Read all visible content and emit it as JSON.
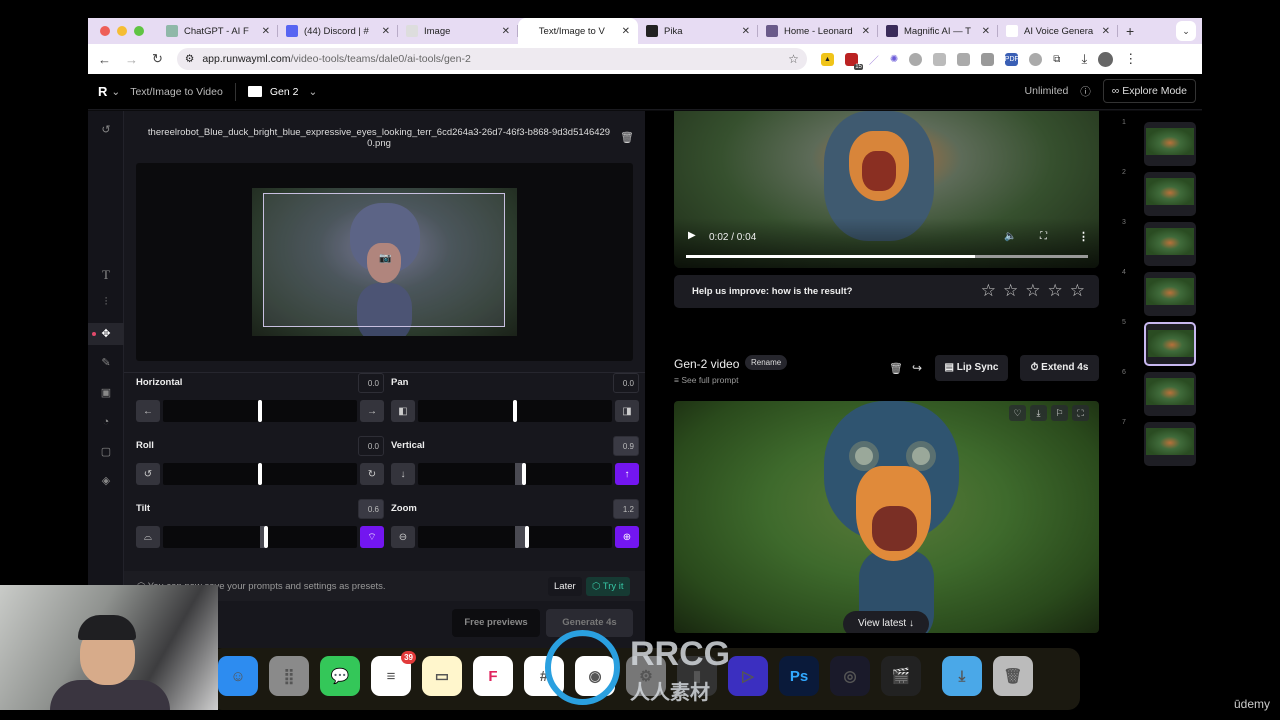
{
  "browser": {
    "tabs": [
      {
        "title": "ChatGPT - AI F",
        "favicon": "chatgpt-icon",
        "color": "#8fb8a8"
      },
      {
        "title": "(44) Discord | #",
        "favicon": "discord-icon",
        "color": "#5865f2"
      },
      {
        "title": "Image",
        "favicon": "image-icon",
        "color": "#dddddd"
      },
      {
        "title": "Text/Image to V",
        "favicon": "",
        "color": "#ffffff",
        "active": true
      },
      {
        "title": "Pika",
        "favicon": "pika-icon",
        "color": "#222222"
      },
      {
        "title": "Home - Leonard",
        "favicon": "leonardo-icon",
        "color": "#6a5a8a"
      },
      {
        "title": "Magnific AI — T",
        "favicon": "magnific-icon",
        "color": "#3a2b5a"
      },
      {
        "title": "AI Voice Genera",
        "favicon": "elevenlabs-icon",
        "color": "#ffffff"
      }
    ],
    "url_host": "app.runwayml.com",
    "url_path": "/video-tools/teams/dale0/ai-tools/gen-2",
    "extension_badge": "15"
  },
  "app": {
    "breadcrumb_tool": "Text/Image to Video",
    "folder": "Gen 2",
    "plan": "Unlimited",
    "explore_mode": "Explore Mode"
  },
  "left_panel": {
    "filename": "thereelrobot_Blue_duck_bright_blue_expressive_eyes_looking_terr_6cd264a3-26d7-46f3-b868-9d3d51464290.png",
    "controls": [
      {
        "label": "Horizontal",
        "value": "0.0",
        "position": 0.5,
        "active_side": ""
      },
      {
        "label": "Pan",
        "value": "0.0",
        "position": 0.5,
        "active_side": ""
      },
      {
        "label": "Roll",
        "value": "0.0",
        "position": 0.5,
        "active_side": ""
      },
      {
        "label": "Vertical",
        "value": "0.9",
        "position": 0.545,
        "active_side": "right"
      },
      {
        "label": "Tilt",
        "value": "0.6",
        "position": 0.53,
        "active_side": "right"
      },
      {
        "label": "Zoom",
        "value": "1.2",
        "position": 0.56,
        "active_side": "right"
      }
    ],
    "presets_text": "You can now save your prompts and settings as presets.",
    "later": "Later",
    "try_it": "Try it",
    "free_previews": "Free previews",
    "generate": "Generate 4s"
  },
  "right_panel": {
    "video_time": "0:02 / 0:04",
    "video_progress": 0.72,
    "rating_question": "Help us improve: how is the result?",
    "rating_stars": 5,
    "rating_value": 0,
    "video_title": "Gen-2 video",
    "rename": "Rename",
    "see_full_prompt": "See full prompt",
    "lip_sync": "Lip Sync",
    "extend": "Extend 4s",
    "view_latest": "View latest ↓"
  },
  "timeline": {
    "items": [
      "1",
      "2",
      "3",
      "4",
      "5",
      "6",
      "7"
    ],
    "selected": "5"
  },
  "dock": {
    "reminders_badge": "39",
    "apps": [
      "Finder",
      "Launchpad",
      "Messages",
      "Reminders",
      "Notes",
      "Framer",
      "Slack",
      "Chrome",
      "Settings",
      "Terminal",
      "Topaz",
      "Photoshop",
      "OBS",
      "Final Cut Pro",
      "Downloads",
      "Trash"
    ]
  },
  "watermark": {
    "brand": "RRCG",
    "sub": "人人素材",
    "platform": "ūdemy"
  }
}
